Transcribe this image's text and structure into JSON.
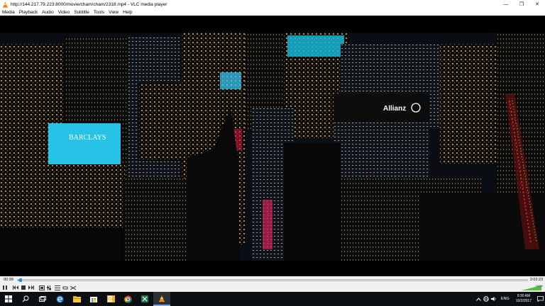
{
  "window": {
    "title": "http://144.217.79.223:8000/movie/cham/cham/2318.mp4 - VLC media player",
    "buttons": [
      {
        "name": "minimize-icon",
        "glyph": "—"
      },
      {
        "name": "maximize-icon",
        "glyph": "❐"
      },
      {
        "name": "close-icon",
        "glyph": "✕"
      }
    ]
  },
  "menu": [
    "Media",
    "Playback",
    "Audio",
    "Video",
    "Subtitle",
    "Tools",
    "View",
    "Help"
  ],
  "video": {
    "building_sign_1": "BARCLAYS",
    "building_sign_2": "Allianz"
  },
  "playback": {
    "elapsed": "00:39",
    "total": "2:02:23",
    "progress": 0.005
  },
  "controls": [
    "pause-icon",
    "previous-icon",
    "stop-icon",
    "next-icon",
    "fullscreen-icon",
    "extended-settings-icon",
    "playlist-icon",
    "loop-icon",
    "shuffle-icon"
  ],
  "volume": {
    "level": "100%",
    "value": 1.0
  },
  "taskbar": {
    "apps": [
      "windows-start-icon",
      "search-icon",
      "task-view-icon",
      "edge-icon",
      "file-explorer-icon",
      "store-icon",
      "outlook-icon",
      "chrome-icon",
      "excel-icon",
      "vlc-icon"
    ],
    "language": "ENG",
    "time": "9:30 AM",
    "date": "10/2/2017"
  },
  "colors": {
    "accent": "#1e8fe0",
    "taskbar": "#0b0f14",
    "vlc": "#f08a00",
    "barclays": "#27c3e6"
  }
}
